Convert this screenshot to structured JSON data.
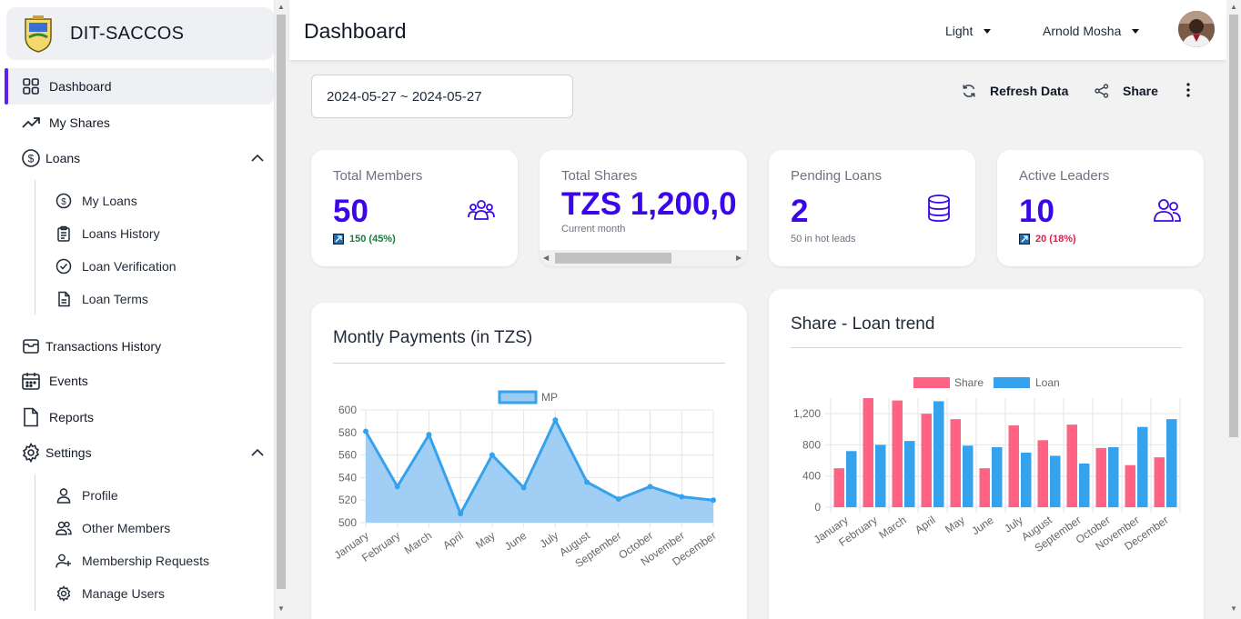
{
  "app": {
    "name": "DIT-SACCOS"
  },
  "sidebar": {
    "items": [
      {
        "label": "Dashboard",
        "icon": "grid-icon",
        "active": true
      },
      {
        "label": "My Shares",
        "icon": "trending-up-icon"
      },
      {
        "label": "Loans",
        "icon": "dollar-circle-icon",
        "expanded": true
      },
      {
        "label": "Transactions History",
        "icon": "archive-icon"
      },
      {
        "label": "Events",
        "icon": "calendar-icon"
      },
      {
        "label": "Reports",
        "icon": "document-icon"
      },
      {
        "label": "Settings",
        "icon": "gear-icon",
        "expanded": true
      }
    ],
    "loans_sub": [
      {
        "label": "My Loans",
        "icon": "dollar-circle-icon"
      },
      {
        "label": "Loans History",
        "icon": "clipboard-icon"
      },
      {
        "label": "Loan Verification",
        "icon": "check-circle-icon"
      },
      {
        "label": "Loan Terms",
        "icon": "file-text-icon"
      }
    ],
    "settings_sub": [
      {
        "label": "Profile",
        "icon": "user-icon"
      },
      {
        "label": "Other Members",
        "icon": "users-icon"
      },
      {
        "label": "Membership Requests",
        "icon": "user-plus-icon"
      },
      {
        "label": "Manage Users",
        "icon": "cog-icon"
      }
    ]
  },
  "header": {
    "title": "Dashboard",
    "theme": "Light",
    "user": "Arnold Mosha"
  },
  "toolbar": {
    "date_range": "2024-05-27 ~ 2024-05-27",
    "refresh_label": "Refresh Data",
    "share_label": "Share"
  },
  "stats": {
    "total_members": {
      "label": "Total Members",
      "value": "50",
      "sub": "150 (45%)",
      "sub_color": "#15803d"
    },
    "total_shares": {
      "label": "Total Shares",
      "value": "TZS 1,200,0",
      "sub": "Current month"
    },
    "pending_loans": {
      "label": "Pending Loans",
      "value": "2",
      "sub": "50 in hot leads"
    },
    "active_leaders": {
      "label": "Active Leaders",
      "value": "10",
      "sub": "20 (18%)",
      "sub_color": "#e11d48"
    }
  },
  "colors": {
    "accent": "#3b07e8",
    "share": "#ff6384",
    "loan": "#36a2eb",
    "mp_fill": "#9ccbf3",
    "mp_line": "#36a2eb"
  },
  "chart_data": [
    {
      "type": "area",
      "title": "Montly Payments (in TZS)",
      "categories": [
        "January",
        "February",
        "March",
        "April",
        "May",
        "June",
        "July",
        "August",
        "September",
        "October",
        "November",
        "December"
      ],
      "series": [
        {
          "name": "MP",
          "values": [
            581,
            532,
            578,
            508,
            560,
            531,
            591,
            536,
            521,
            532,
            523,
            520
          ]
        }
      ],
      "ylim": [
        500,
        600
      ],
      "yticks": [
        "500",
        "520",
        "540",
        "560",
        "580",
        "600"
      ],
      "grid": true,
      "legend": "top"
    },
    {
      "type": "bar",
      "title": "Share - Loan trend",
      "categories": [
        "January",
        "February",
        "March",
        "April",
        "May",
        "June",
        "July",
        "August",
        "September",
        "October",
        "November",
        "December"
      ],
      "series": [
        {
          "name": "Share",
          "values": [
            500,
            1400,
            1370,
            1200,
            1130,
            500,
            1050,
            860,
            1060,
            760,
            540,
            640
          ]
        },
        {
          "name": "Loan",
          "values": [
            720,
            800,
            850,
            1360,
            790,
            770,
            700,
            660,
            560,
            770,
            1030,
            1130
          ]
        }
      ],
      "ylim": [
        0,
        1400
      ],
      "yticks": [
        "0",
        "400",
        "800",
        "1,200"
      ],
      "grid": true,
      "legend": "top"
    }
  ]
}
